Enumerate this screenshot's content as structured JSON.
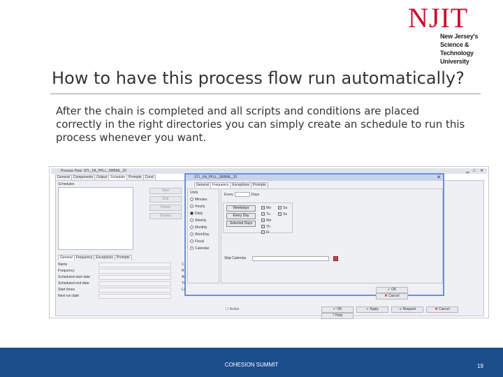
{
  "logo": {
    "name": "NJIT",
    "line1": "New Jersey's Science &",
    "line2": "Technology University",
    "color": "#c8102e"
  },
  "slide": {
    "title": "How to have this process flow run automatically?",
    "body": "After the chain is completed and all scripts and conditions are placed correctly in the right directories you can simply create an schedule to run this process whenever you want."
  },
  "app_window": {
    "title": "Process Flow: STL_FA_PFLL_SRBML_20",
    "tabs": [
      "General",
      "Components",
      "Output",
      "Schedule",
      "Prompts",
      "Cond"
    ],
    "schedules_label": "Schedules",
    "side_buttons": [
      "New",
      "Edit",
      "Delete",
      "Display"
    ],
    "lower_tabs": [
      "General",
      "Frequency",
      "Exceptions",
      "Prompts"
    ],
    "properties": [
      "Name",
      "Frequency",
      "Scheduled start date",
      "Scheduled end date",
      "Start times",
      "Next run date"
    ],
    "right_properties": [
      "Crea",
      "Req",
      "Ageo",
      "Time",
      "Last"
    ],
    "active_label": "Active",
    "buttons": [
      "OK",
      "Apply",
      "Request",
      "Cancel",
      "Help"
    ]
  },
  "dialog": {
    "title": "STL_FA_PFLL_SRBML_20",
    "tabs": [
      "General",
      "Frequency",
      "Exceptions",
      "Prompts"
    ],
    "units_label": "Units",
    "units": [
      {
        "label": "Minutes",
        "selected": false
      },
      {
        "label": "Hourly",
        "selected": false
      },
      {
        "label": "Daily",
        "selected": true
      },
      {
        "label": "Weekly",
        "selected": false
      },
      {
        "label": "Monthly",
        "selected": false
      },
      {
        "label": "WorkDay",
        "selected": false
      },
      {
        "label": "Fiscal",
        "selected": false
      },
      {
        "label": "Calendar",
        "selected": false
      }
    ],
    "every_label": "Every",
    "every_unit": "Days",
    "day_buttons": [
      "Weekdays",
      "Every Day",
      "Selected Days"
    ],
    "days": [
      {
        "label": "Mo",
        "checked": true
      },
      {
        "label": "Tu",
        "checked": true
      },
      {
        "label": "We",
        "checked": true
      },
      {
        "label": "Th",
        "checked": true
      },
      {
        "label": "Fr",
        "checked": true
      },
      {
        "label": "Sa",
        "checked": true
      },
      {
        "label": "Su",
        "checked": true
      }
    ],
    "skip_label": "Skip Calendar",
    "ok": "OK",
    "cancel": "Cancel"
  },
  "footer": {
    "center": "COHESION SUMMIT",
    "page": "19",
    "color": "#1c4e8c"
  }
}
